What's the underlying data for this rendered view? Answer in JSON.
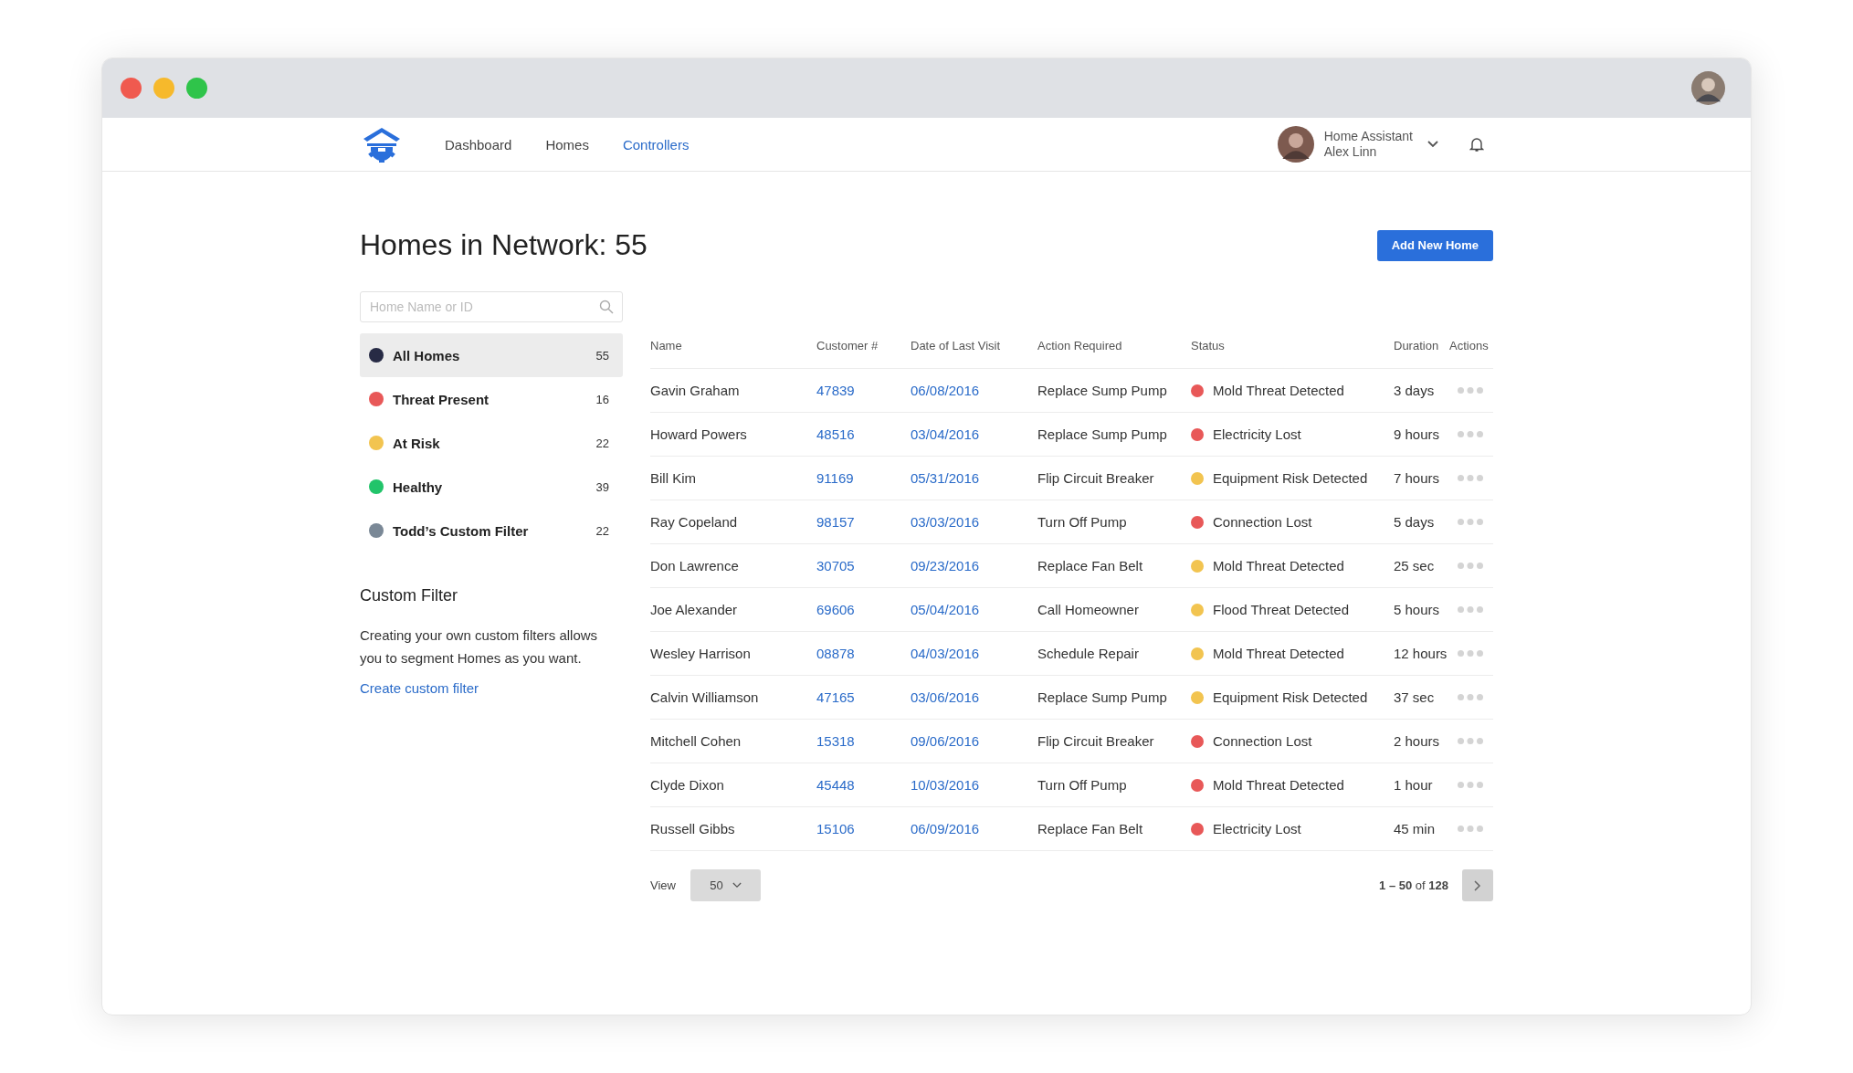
{
  "nav": {
    "links": [
      {
        "label": "Dashboard",
        "selected": false
      },
      {
        "label": "Homes",
        "selected": false
      },
      {
        "label": "Controllers",
        "selected": true
      }
    ],
    "user": {
      "role": "Home Assistant",
      "name": "Alex Linn"
    }
  },
  "page": {
    "title": "Homes in Network: 55",
    "add_button": "Add New Home"
  },
  "sidebar": {
    "search": {
      "placeholder": "Home Name or ID"
    },
    "filters": [
      {
        "label": "All Homes",
        "count": "55",
        "color": "#272b45",
        "selected": true
      },
      {
        "label": "Threat Present",
        "count": "16",
        "color": "#e85858",
        "selected": false
      },
      {
        "label": "At Risk",
        "count": "22",
        "color": "#f2c450",
        "selected": false
      },
      {
        "label": "Healthy",
        "count": "39",
        "color": "#22c46a",
        "selected": false
      },
      {
        "label": "Todd’s Custom Filter",
        "count": "22",
        "color": "#7a8896",
        "selected": false
      }
    ],
    "custom_filter": {
      "heading": "Custom Filter",
      "text": "Creating your own custom filters allows you to segment Homes as you want.",
      "link": "Create custom filter"
    }
  },
  "table": {
    "columns": [
      "Name",
      "Customer #",
      "Date of Last Visit",
      "Action Required",
      "Status",
      "Duration",
      "Actions"
    ],
    "rows": [
      {
        "name": "Gavin Graham",
        "customer": "47839",
        "date": "06/08/2016",
        "action": "Replace Sump Pump",
        "status": "Mold Threat Detected",
        "color": "#e85858",
        "duration": "3 days"
      },
      {
        "name": "Howard Powers",
        "customer": "48516",
        "date": "03/04/2016",
        "action": "Replace Sump Pump",
        "status": "Electricity Lost",
        "color": "#e85858",
        "duration": "9 hours"
      },
      {
        "name": "Bill Kim",
        "customer": "91169",
        "date": "05/31/2016",
        "action": "Flip Circuit Breaker",
        "status": "Equipment Risk Detected",
        "color": "#f2c450",
        "duration": "7 hours"
      },
      {
        "name": "Ray Copeland",
        "customer": "98157",
        "date": "03/03/2016",
        "action": "Turn Off Pump",
        "status": "Connection Lost",
        "color": "#e85858",
        "duration": "5 days"
      },
      {
        "name": "Don Lawrence",
        "customer": "30705",
        "date": "09/23/2016",
        "action": "Replace Fan Belt",
        "status": "Mold Threat Detected",
        "color": "#f2c450",
        "duration": "25 sec"
      },
      {
        "name": "Joe Alexander",
        "customer": "69606",
        "date": "05/04/2016",
        "action": "Call Homeowner",
        "status": "Flood Threat Detected",
        "color": "#f2c450",
        "duration": "5 hours"
      },
      {
        "name": "Wesley Harrison",
        "customer": "08878",
        "date": "04/03/2016",
        "action": "Schedule Repair",
        "status": "Mold Threat Detected",
        "color": "#f2c450",
        "duration": "12 hours"
      },
      {
        "name": "Calvin Williamson",
        "customer": "47165",
        "date": "03/06/2016",
        "action": "Replace Sump Pump",
        "status": "Equipment Risk Detected",
        "color": "#f2c450",
        "duration": "37 sec"
      },
      {
        "name": "Mitchell Cohen",
        "customer": "15318",
        "date": "09/06/2016",
        "action": "Flip Circuit Breaker",
        "status": "Connection Lost",
        "color": "#e85858",
        "duration": "2 hours"
      },
      {
        "name": "Clyde Dixon",
        "customer": "45448",
        "date": "10/03/2016",
        "action": "Turn Off Pump",
        "status": "Mold Threat Detected",
        "color": "#e85858",
        "duration": "1 hour"
      },
      {
        "name": "Russell Gibbs",
        "customer": "15106",
        "date": "06/09/2016",
        "action": "Replace Fan Belt",
        "status": "Electricity Lost",
        "color": "#e85858",
        "duration": "45 min"
      }
    ]
  },
  "pagination": {
    "view_label": "View",
    "per_page": "50",
    "range": "**1 – 50** of **128**"
  }
}
